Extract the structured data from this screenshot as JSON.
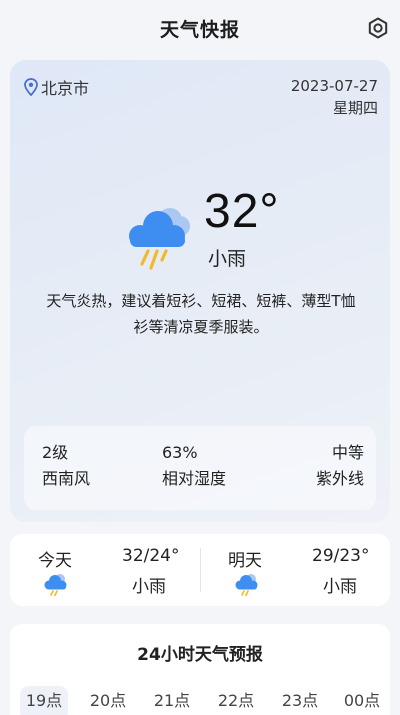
{
  "header": {
    "title": "天气快报",
    "settings_icon": "settings-gear-icon"
  },
  "current": {
    "city": "北京市",
    "date": "2023-07-27",
    "weekday": "星期四",
    "temperature": "32°",
    "condition": "小雨",
    "icon": "cloud-rain-icon",
    "advice": "天气炎热，建议着短衫、短裙、短裤、薄型T恤衫等清凉夏季服装。"
  },
  "stats": {
    "wind_level": "2级",
    "wind_dir": "西南风",
    "humidity_value": "63%",
    "humidity_label": "相对湿度",
    "uv_value": "中等",
    "uv_label": "紫外线"
  },
  "forecast": [
    {
      "day": "今天",
      "range": "32/24°",
      "condition": "小雨",
      "icon": "cloud-rain-icon"
    },
    {
      "day": "明天",
      "range": "29/23°",
      "condition": "小雨",
      "icon": "cloud-rain-icon"
    }
  ],
  "hourly": {
    "title": "24小时天气预报",
    "hours": [
      "19点",
      "20点",
      "21点",
      "22点",
      "23点",
      "00点"
    ]
  },
  "colors": {
    "cloud_blue": "#3d8ef0",
    "rain_yellow": "#f2b92a",
    "card_bg": "#e2eaf6"
  }
}
